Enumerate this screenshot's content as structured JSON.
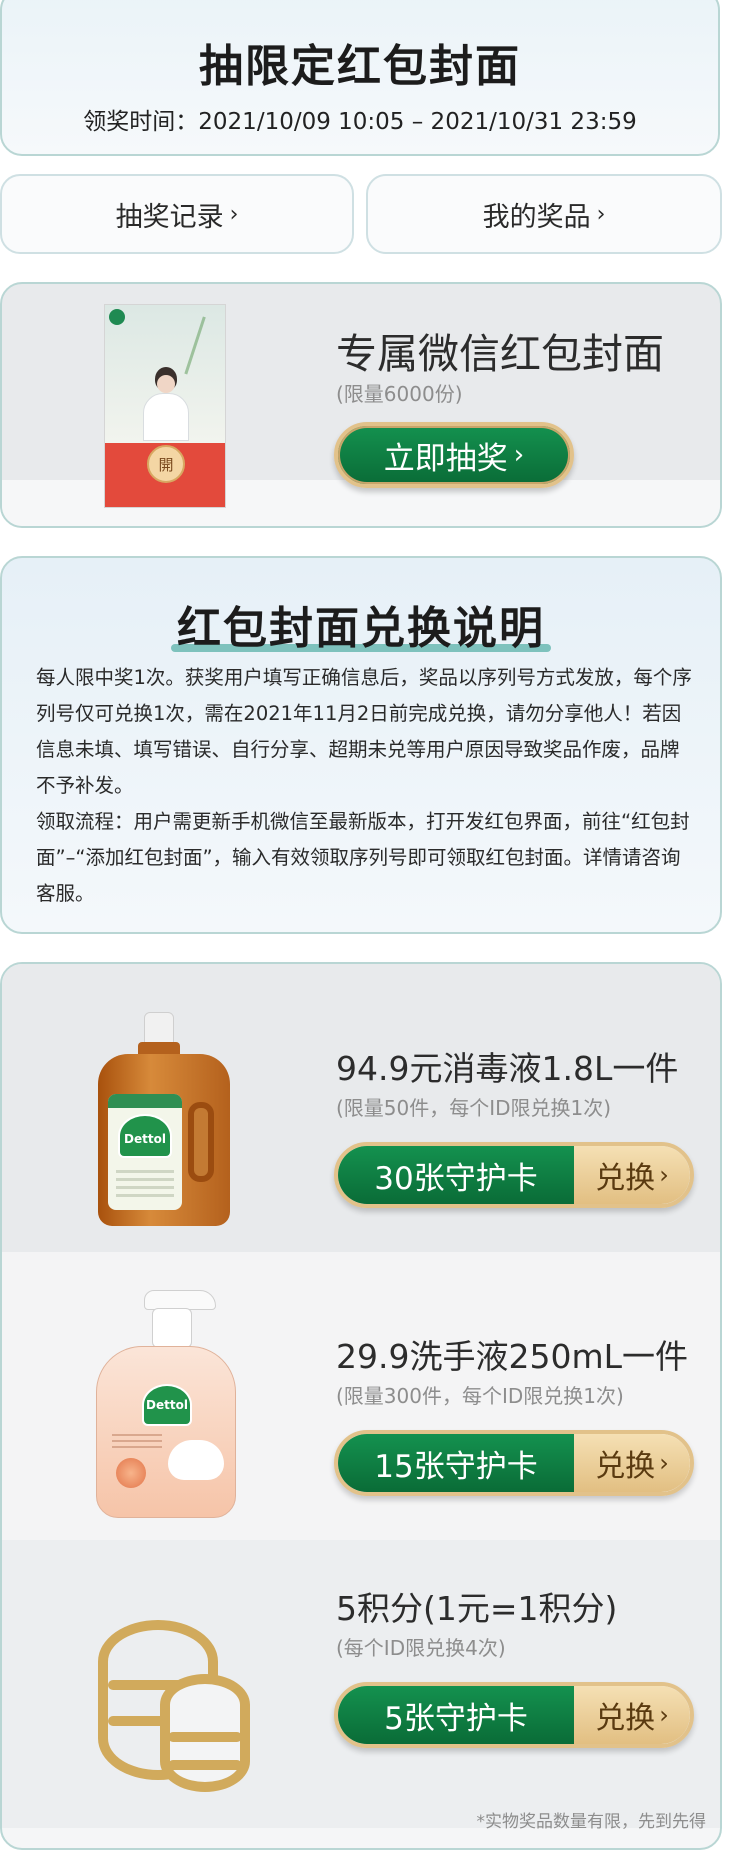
{
  "header": {
    "title": "抽限定红包封面",
    "period": "领奖时间：2021/10/09 10:05 – 2021/10/31 23:59"
  },
  "records": {
    "draw_record": "抽奖记录",
    "my_prizes": "我的奖品",
    "chevron": "›"
  },
  "packet": {
    "title": "专属微信红包封面",
    "subtitle": "(限量6000份)",
    "button": "立即抽奖",
    "seal_text": "開"
  },
  "rules": {
    "title": "红包封面兑换说明",
    "paragraphs": [
      "每人限中奖1次。获奖用户填写正确信息后，奖品以序列号方式发放，每个序列号仅可兑换1次，需在2021年11月2日前完成兑换，请勿分享他人！若因信息未填、填写错误、自行分享、超期未兑等用户原因导致奖品作废，品牌不予补发。",
      "领取流程：用户需更新手机微信至最新版本，打开发红包界面，前往“红包封面”–“添加红包封面”，输入有效领取序列号即可领取红包封面。详情请咨询客服。"
    ]
  },
  "exchange": {
    "items": [
      {
        "title": "94.9元消毒液1.8L一件",
        "subtitle": "(限量50件，每个ID限兑换1次)",
        "cost": "30张守护卡",
        "action": "兑换"
      },
      {
        "title": "29.9洗手液250mL一件",
        "subtitle": "(限量300件，每个ID限兑换1次)",
        "cost": "15张守护卡",
        "action": "兑换"
      },
      {
        "title": "5积分(1元=1积分)",
        "subtitle": "(每个ID限兑换4次)",
        "cost": "5张守护卡",
        "action": "兑换"
      }
    ],
    "footnote": "*实物奖品数量有限，先到先得",
    "brand_mark": "Dettol"
  },
  "colors": {
    "accent_green": "#0a6c37",
    "gold": "#e2c28a",
    "border": "#b9d6d4"
  }
}
